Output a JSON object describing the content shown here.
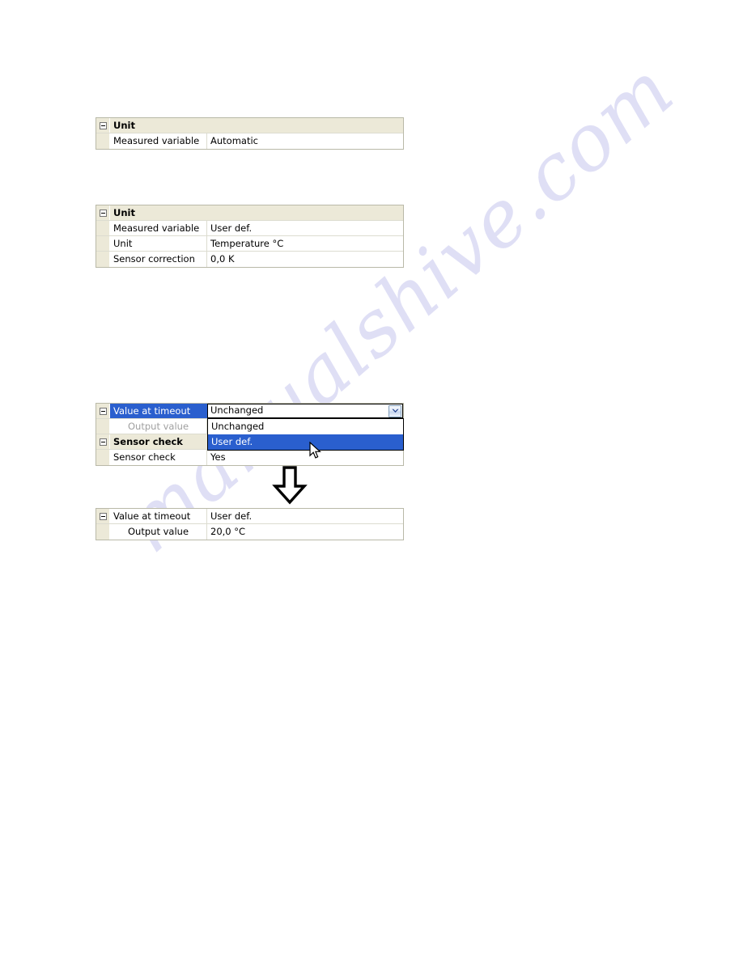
{
  "page": {
    "background_color": "#ffffff",
    "watermark_text": "manualshive.com",
    "watermark_color": "#cdcdef"
  },
  "colors": {
    "selection_blue": "#2a5fce",
    "category_beige": "#ece9d8",
    "grid_border": "#b9b9a8",
    "row_divider": "#dcdcd0",
    "disabled_text": "#a0a0a0"
  },
  "grids": [
    {
      "id": "unit-automatic",
      "rows": [
        {
          "type": "category",
          "expander": "collapse-box",
          "name": "Unit",
          "value": ""
        },
        {
          "type": "property",
          "name": "Measured variable",
          "value": "Automatic"
        }
      ]
    },
    {
      "id": "unit-userdef",
      "rows": [
        {
          "type": "category",
          "expander": "collapse-box",
          "name": "Unit",
          "value": ""
        },
        {
          "type": "property",
          "name": "Measured variable",
          "value": "User def."
        },
        {
          "type": "property",
          "name": "Unit",
          "value": "Temperature °C"
        },
        {
          "type": "property",
          "name": "Sensor correction",
          "value": "0,0 K"
        }
      ]
    },
    {
      "id": "timeout-dropdown-open",
      "rows": [
        {
          "type": "category-selected",
          "expander": "collapse-box",
          "name": "Value at timeout",
          "value": "Unchanged",
          "editor": true
        },
        {
          "type": "property-child-disabled",
          "name": "Output value",
          "value": ""
        },
        {
          "type": "category",
          "expander": "collapse-box",
          "name": "Sensor check",
          "value": ""
        },
        {
          "type": "property",
          "name": "Sensor check",
          "value": "Yes"
        }
      ],
      "dropdown": {
        "options": [
          "Unchanged",
          "User def."
        ],
        "highlighted_index": 1
      }
    },
    {
      "id": "timeout-result",
      "rows": [
        {
          "type": "category",
          "expander": "collapse-box",
          "name": "Value at timeout",
          "value": "User def."
        },
        {
          "type": "property-child",
          "name": "Output value",
          "value": "20,0 °C"
        }
      ]
    }
  ],
  "flow_arrow": {
    "direction": "down",
    "label": "results-in-arrow"
  },
  "cursor": {
    "type": "arrow-pointer"
  }
}
